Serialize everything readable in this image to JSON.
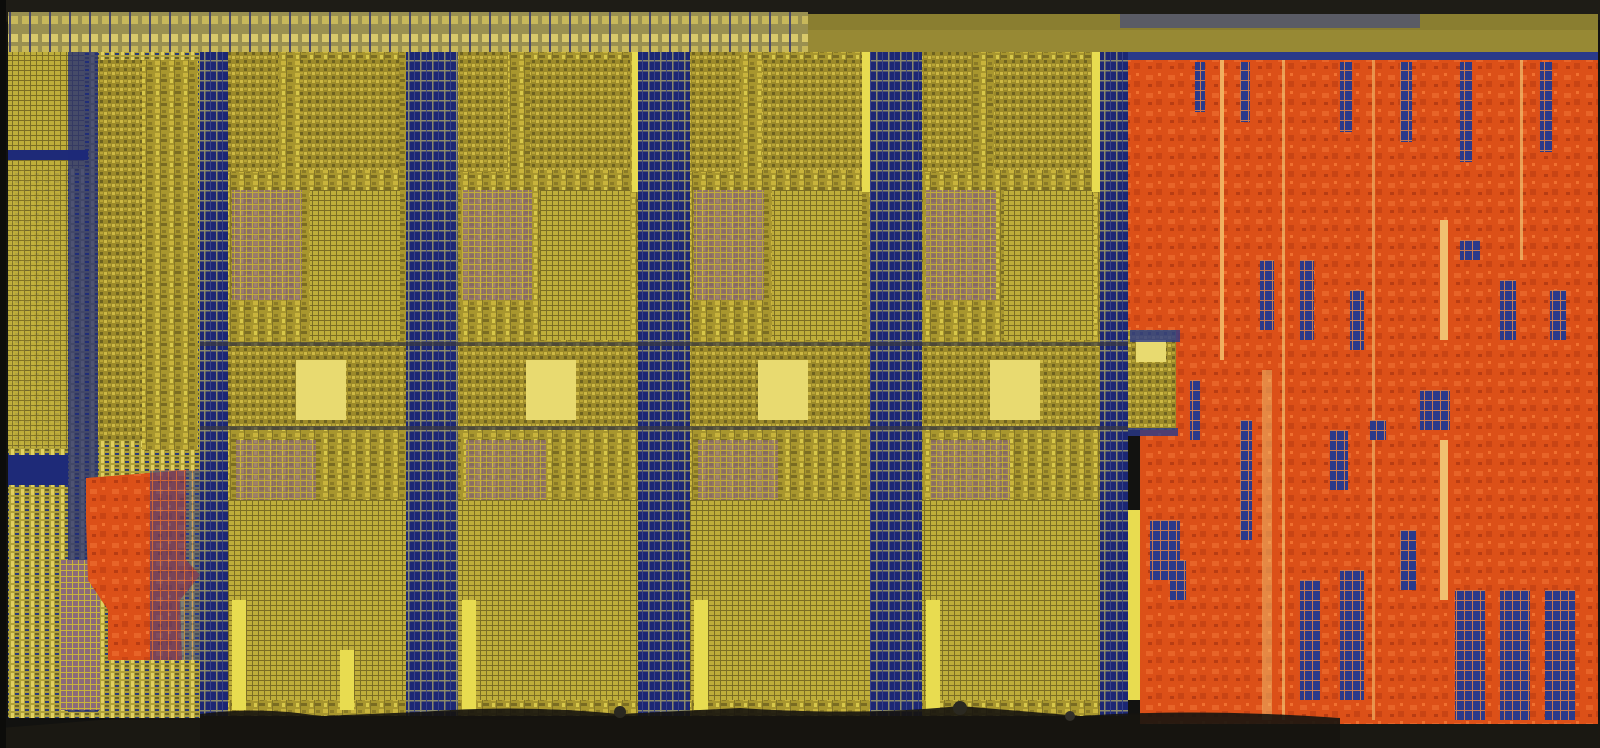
{
  "image": {
    "subject": "die-shot",
    "colors": {
      "background": "#121210",
      "package_edge": "#2a2820",
      "die_gold": "#a8962e",
      "die_gold_light": "#d8c84a",
      "die_gold_dark": "#6e6220",
      "wire_blue": "#1e2a78",
      "wire_blue_dark": "#0f1850",
      "cache_orange": "#e0521a",
      "cache_orange_dark": "#b83a12",
      "highlight_yellow": "#f0e050",
      "purple": "#7a5a8a"
    }
  }
}
